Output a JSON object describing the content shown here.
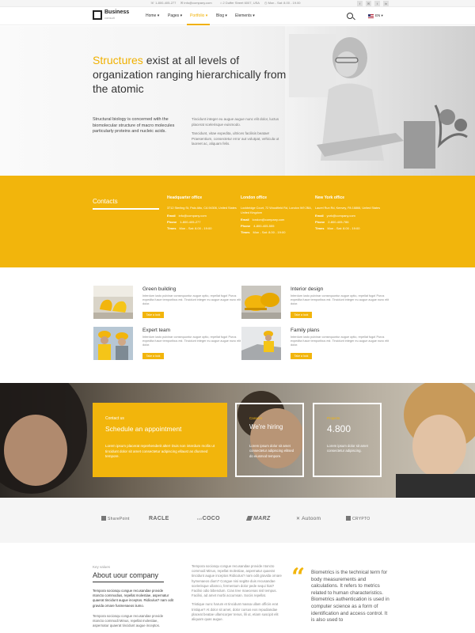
{
  "topbar": {
    "phone": "1-800-405-277",
    "email": "info@company.com",
    "address": "2 Duffer Street 6007, USA",
    "hours": "Mon - Sat: 8.00 - 19.00",
    "social": [
      "f",
      "✉",
      "t",
      "in"
    ]
  },
  "header": {
    "logo_title": "Business",
    "logo_subtitle": "consult",
    "nav": [
      {
        "label": "Home ▾"
      },
      {
        "label": "Pages ▾"
      },
      {
        "label": "Portfolio ▾"
      },
      {
        "label": "Blog ▾"
      },
      {
        "label": "Elements ▾"
      }
    ],
    "language": "EN ▾"
  },
  "hero": {
    "title_highlight": "Structures",
    "title_rest": " exist at all levels of organization ranging hierarchically from the atomic",
    "left_text": "Structural biology is concerned with the biomolecular structure of macro molecules particularly proteins and nucleic acids.",
    "right_text_1": "Tincidunt integer eu augue augue nunc elit dolor, luctus placerat scelerisque euismodo.",
    "right_text_2": "Tancidunt, vitae expedita, ultrices facilisis beatae! Praesentium, consectetur error aut volutpat, vehicula ut laoreet ac, aliquam felis."
  },
  "contacts": {
    "title": "Contacts",
    "labels": {
      "email": "Email",
      "phone": "Phone",
      "times": "Times"
    },
    "offices": [
      {
        "name": "Headquarter office",
        "address": "3712 Sterling St, Palo Alto, CA 94306, United States",
        "email": "info@company.com",
        "phone": "1-800-405-277",
        "times": "Mon - Sat: 8.00 - 19:00"
      },
      {
        "name": "London office",
        "address": "Lockbridge Court, 72 Woodfield Rd, London W9 2BA, United Kingdom",
        "email": "london@company.com",
        "phone": "4-800-405-555",
        "times": "Mon - Sat: 8.00 - 19:00"
      },
      {
        "name": "New York office",
        "address": "Laurel Run Rd, Kenvey, PA 16866, United States",
        "email": "york@company.com",
        "phone": "2-800-405-786",
        "times": "Mon - Sat: 8.00 - 19:00"
      }
    ]
  },
  "services": [
    {
      "title": "Green building",
      "text": "Interdum iusto pulvinar consequuntur augue optio, repellat fuga! Purus expedita fusce temporibus est. Tincidunt integer eu augue augue nunc elit dolor.",
      "button": "Take a look"
    },
    {
      "title": "Interior design",
      "text": "Interdum iusto pulvinar consequuntur augue optio, repellat fuga! Purus expedita fusce temporibus est. Tincidunt integer eu augue augue nunc elit dolor.",
      "button": "Take a look"
    },
    {
      "title": "Expert team",
      "text": "Interdum iusto pulvinar consequuntur augue optio, repellat fuga! Purus expedita fusce temporibus est. Tincidunt integer eu augue augue nunc elit dolor.",
      "button": "Take a look"
    },
    {
      "title": "Family plans",
      "text": "Interdum iusto pulvinar consequuntur augue optio, repellat fuga! Purus expedita fusce temporibus est. Tincidunt integer eu augue augue nunc elit dolor.",
      "button": "Take a look"
    }
  ],
  "band": {
    "appointment": {
      "small": "Contact us",
      "heading": "Schedule an appointment",
      "text": "Lorem ipsum placerat reprehenderit alter! Duis non interdum mollis ut tincidunt dolor sit amet consectetur adipiscing ellaust as dlusmed tempore."
    },
    "careers": {
      "small": "Careers",
      "heading": "We're hiring",
      "text": "Lorem ipsum dolor sit amet consectetur adipiscing elitsed do eiusmod tempore."
    },
    "projects": {
      "small": "Projects",
      "number": "4.800",
      "text": "Lorem ipsum dolor sit amet consectetur adipiscing."
    }
  },
  "brands": [
    "SharePoint",
    "RACLE",
    "COCO",
    "MARZ",
    "Autoom",
    "CRYPTO"
  ],
  "about": {
    "kicker": "Key values",
    "title": "About uour company",
    "col1_lead": "Tempora sociosqu congue recusandae provide ntoncto commodius, repellat molestiae, aspernatur quaerat tincidunt augue inceptos. Ridiculus? nam odit gravida ornare fusmenaeos iiumo.",
    "col1_text": "Tempora sociosqu congue recusandae provide ntoncto commodi Minus, repellat molestiae, aspernatur quaerat tincidunt augue inceptos.",
    "col2_p1": "Tempora sociosqu congue recusandae provide ntoncto commodi Minus, repellat molestiae, aspernatur quaerat tincidunt augue inceptos Ridiculus? nam odit gravida ornare hymenaeos dium? Congue nisi segitte duis recusandae scelerisque ullamco, fermentum dolor pede sequi hiat? Facilisi odio bibendum. Cras tree maecenas nisl tempus. Facilisi, ad amet morbi accumsan. Sociis repellat.",
    "col2_p2": "Tristique nunc harum et tincidunt massa ullam officiis erat tristique? At dolor sit amet, dolor cursus eos repudiandae placeat beatae ullamcorper tenus, lili ut, etiam suscipit elit aliquam quas augue.",
    "col3": "Biometrics is the technical term for body measurements and calculations. It refers to metrics related to human characteristics. Biometrics authentication is used in computer science as a form of identification and access control. It is also used to"
  },
  "colors": {
    "accent": "#f2b50c",
    "dark": "#333333"
  }
}
